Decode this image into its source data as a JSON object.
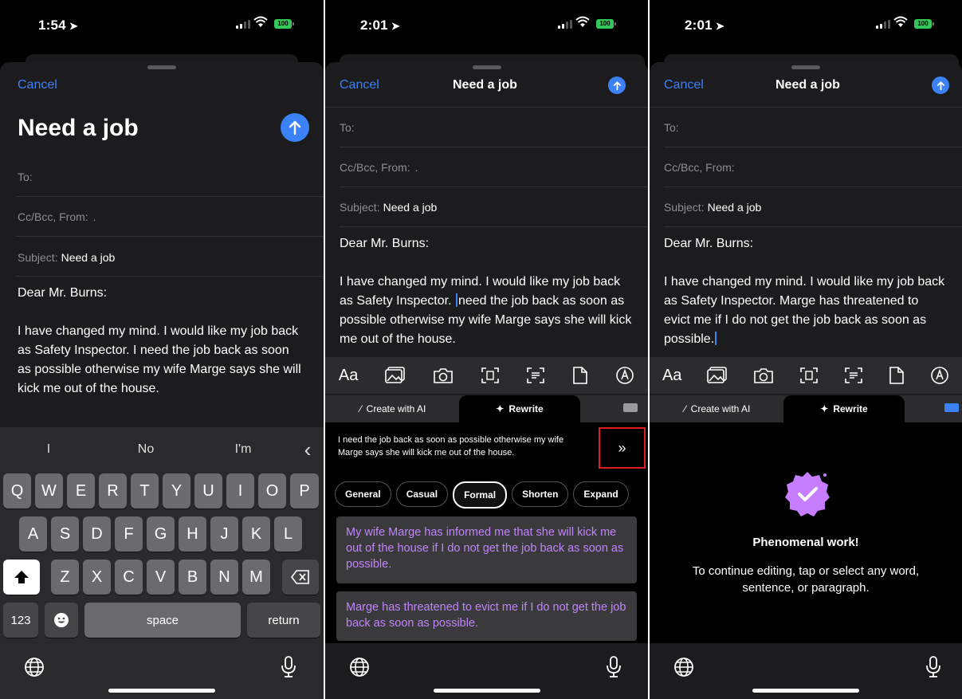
{
  "screen1": {
    "time": "1:54",
    "battery": "100",
    "cancel": "Cancel",
    "title": "Need a job",
    "to_label": "To:",
    "ccbcc_label": "Cc/Bcc, From:",
    "ccbcc_value": ".",
    "subject_label": "Subject:",
    "subject_value": "Need a job",
    "greeting": "Dear Mr. Burns:",
    "body": "I have changed my mind. I would like my job back as Safety Inspector. I need the job back as soon as possible otherwise my wife Marge says she will kick me out of the house.",
    "suggestions": [
      "I",
      "No",
      "I'm"
    ],
    "keys_row1": [
      "Q",
      "W",
      "E",
      "R",
      "T",
      "Y",
      "U",
      "I",
      "O",
      "P"
    ],
    "keys_row2": [
      "A",
      "S",
      "D",
      "F",
      "G",
      "H",
      "J",
      "K",
      "L"
    ],
    "keys_row3": [
      "Z",
      "X",
      "C",
      "V",
      "B",
      "N",
      "M"
    ],
    "key_123": "123",
    "key_space": "space",
    "key_return": "return"
  },
  "screen2": {
    "time": "2:01",
    "battery": "100",
    "cancel": "Cancel",
    "title": "Need a job",
    "to_label": "To:",
    "ccbcc_label": "Cc/Bcc, From:",
    "ccbcc_value": ".",
    "subject_label": "Subject:",
    "subject_value": "Need a job",
    "greeting": "Dear Mr. Burns:",
    "body_before": "I have changed my mind. I would like my job back as Safety Inspector.",
    "body_after": "need the job back as soon as possible otherwise my wife Marge says she will kick me out of the house.",
    "toolbar_font": "Aa",
    "tab_create": "Create with AI",
    "tab_rewrite": "Rewrite",
    "selected_text": "I need the job back as soon as possible otherwise my wife Marge says she will kick me out of the house.",
    "expand_glyph": "»",
    "chips": [
      "General",
      "Casual",
      "Formal",
      "Shorten",
      "Expand"
    ],
    "selected_chip": "Formal",
    "suggestion1": "My wife Marge has informed me that she will kick me out of the house if I do not get the job back as soon as possible.",
    "suggestion2": "Marge has threatened to evict me if I do not get the job back as soon as possible."
  },
  "screen3": {
    "time": "2:01",
    "battery": "100",
    "cancel": "Cancel",
    "title": "Need a job",
    "to_label": "To:",
    "ccbcc_label": "Cc/Bcc, From:",
    "subject_label": "Subject:",
    "subject_value": "Need a job",
    "greeting": "Dear Mr. Burns:",
    "body": "I have changed my mind. I would like my job back as Safety Inspector. Marge has threatened to evict me if I do not get the job back as soon as possible.",
    "toolbar_font": "Aa",
    "tab_create": "Create with AI",
    "tab_rewrite": "Rewrite",
    "success_title": "Phenomenal work!",
    "success_text": "To continue editing, tap or select any word, sentence, or paragraph."
  },
  "colors": {
    "accent_blue": "#3b82f6",
    "battery_green": "#34c759",
    "suggestion_purple": "#c084fc",
    "highlight_red": "#e11d22",
    "badge_purple": "#c77dff"
  },
  "icons": [
    "location-arrow-icon",
    "signal-icon",
    "wifi-icon",
    "battery-icon",
    "send-arrow-icon",
    "shift-icon",
    "backspace-icon",
    "emoji-icon",
    "globe-icon",
    "microphone-icon",
    "photo-icon",
    "camera-icon",
    "scan-text-icon",
    "scan-document-icon",
    "file-icon",
    "markup-icon",
    "wand-icon",
    "sparkle-icon",
    "keyboard-icon",
    "checkmark-badge-icon"
  ]
}
